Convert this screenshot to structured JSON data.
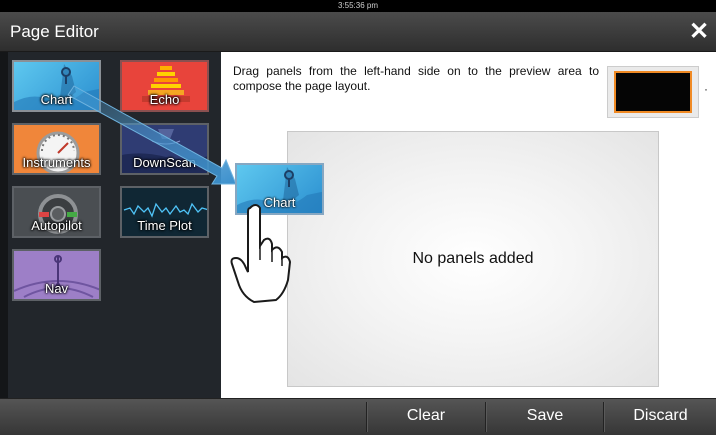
{
  "status": {
    "time": "3:55:36 pm"
  },
  "window": {
    "title": "Page Editor"
  },
  "panels": [
    {
      "label": "Chart"
    },
    {
      "label": "Echo"
    },
    {
      "label": "Instruments"
    },
    {
      "label": "DownScan"
    },
    {
      "label": "Autopilot"
    },
    {
      "label": "Time Plot"
    },
    {
      "label": "Nav"
    }
  ],
  "instructions": "Drag panels from the left-hand side on to the preview area to compose the page layout.",
  "layout_selector": {
    "dropdown_icon": "dot-dropdown-icon",
    "accent": "#f08a24"
  },
  "preview": {
    "empty_text": "No panels added"
  },
  "dragging": {
    "label": "Chart"
  },
  "buttons": {
    "clear": "Clear",
    "save": "Save",
    "discard": "Discard"
  },
  "colors": {
    "chart": "#3aaee6",
    "echo": "#e8443b",
    "instruments": "#f0863a",
    "downscan": "#2f3c73",
    "nav": "#9d7fc7"
  }
}
